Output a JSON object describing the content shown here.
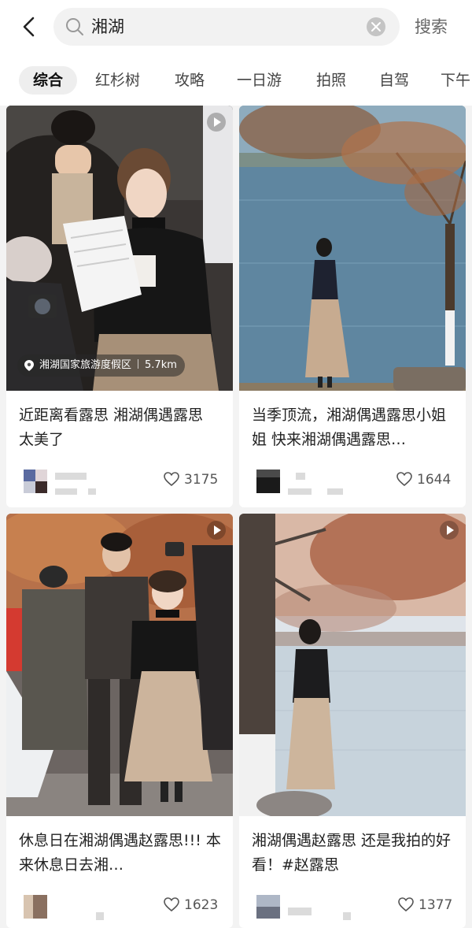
{
  "search": {
    "query": "湘湖",
    "submit_label": "搜索"
  },
  "tabs": [
    "综合",
    "红杉树",
    "攻略",
    "一日游",
    "拍照",
    "自驾",
    "下午"
  ],
  "cards": [
    {
      "title": "近距离看露思 湘湖偶遇露思 太美了",
      "likes": "3175",
      "location": "湘湖国家旅游度假区",
      "distance": "5.7km",
      "video": true
    },
    {
      "title": "当季顶流，湘湖偶遇露思小姐姐 快来湘湖偶遇露思…",
      "likes": "1644",
      "video": false
    },
    {
      "title": "休息日在湘湖偶遇赵露思!!! 本来休息日去湘…",
      "likes": "1623",
      "video": true
    },
    {
      "title": "湘湖偶遇赵露思 还是我拍的好看！#赵露思",
      "likes": "1377",
      "video": true
    }
  ],
  "icons": {
    "back": "chevron-left-icon",
    "search": "search-icon",
    "clear": "close-circle-icon",
    "play": "play-icon",
    "location": "pin-icon",
    "like": "heart-icon"
  },
  "colors": {
    "background": "#f3f3f3",
    "active_tab_bg": "#eeeeee",
    "text": "#222222",
    "muted": "#666666"
  }
}
